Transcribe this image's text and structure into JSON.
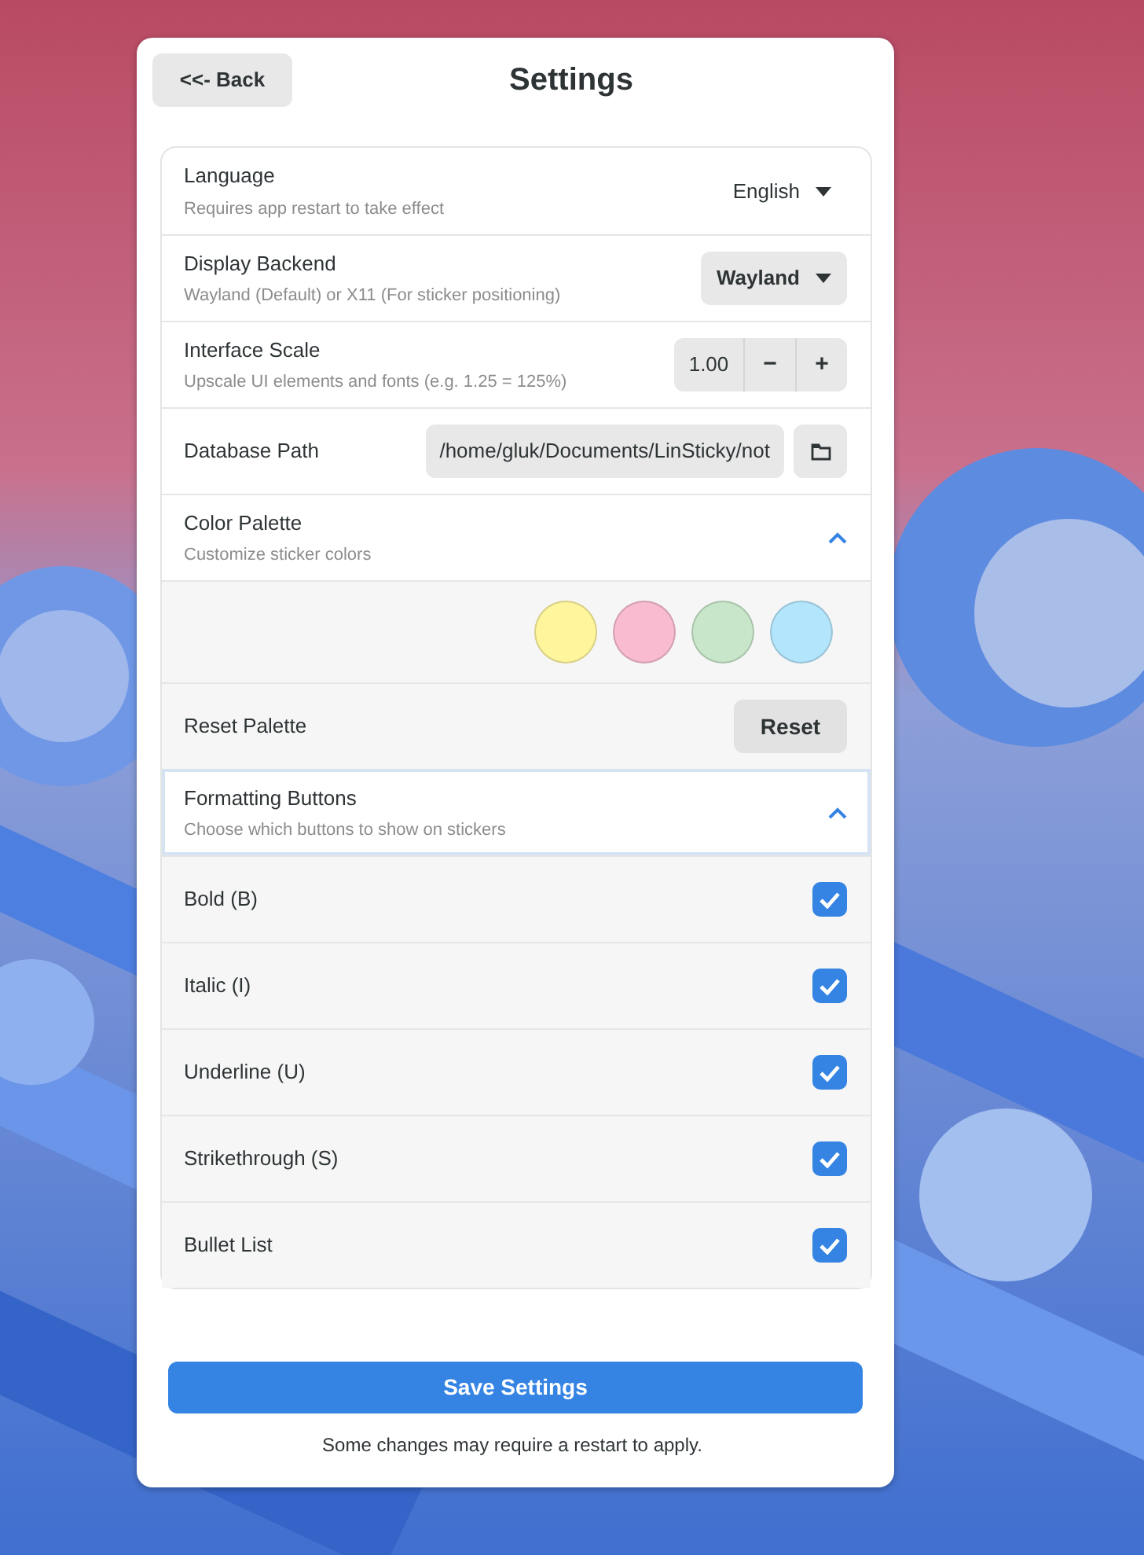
{
  "header": {
    "back_button": "<<- Back",
    "title": "Settings"
  },
  "settings": [
    {
      "kind": "dropdown",
      "label": "Language",
      "description": "Requires app restart to take effect",
      "value": "English",
      "flat": true
    },
    {
      "kind": "dropdown",
      "label": "Display Backend",
      "description": "Wayland (Default) or X11 (For sticker positioning)",
      "value": "Wayland",
      "flat": false
    },
    {
      "kind": "spin",
      "label": "Interface Scale",
      "description": "Upscale UI elements and fonts (e.g. 1.25 = 125%)",
      "value": "1.00",
      "minus": "−",
      "plus": "+"
    },
    {
      "kind": "path",
      "label": "Database Path",
      "value": "/home/gluk/Documents/LinSticky/not"
    },
    {
      "kind": "expander",
      "label": "Color Palette",
      "description": "Customize sticker colors",
      "expanded": true,
      "focused": false,
      "children": [
        {
          "kind": "swatches",
          "swatches": [
            {
              "color": "#fff59d"
            },
            {
              "color": "#f8bbd0"
            },
            {
              "color": "#c8e6c9"
            },
            {
              "color": "#b3e5fc"
            }
          ]
        },
        {
          "kind": "button",
          "label": "Reset Palette",
          "button": "Reset"
        }
      ]
    },
    {
      "kind": "expander",
      "label": "Formatting Buttons",
      "description": "Choose which buttons to show on stickers",
      "expanded": true,
      "focused": true,
      "children": [
        {
          "kind": "check",
          "label": "Bold (B)",
          "checked": true
        },
        {
          "kind": "check",
          "label": "Italic (I)",
          "checked": true
        },
        {
          "kind": "check",
          "label": "Underline (U)",
          "checked": true
        },
        {
          "kind": "check",
          "label": "Strikethrough (S)",
          "checked": true
        },
        {
          "kind": "check",
          "label": "Bullet List",
          "checked": true
        }
      ]
    }
  ],
  "footer": {
    "save_button": "Save Settings",
    "note": "Some changes may require a restart to apply."
  }
}
